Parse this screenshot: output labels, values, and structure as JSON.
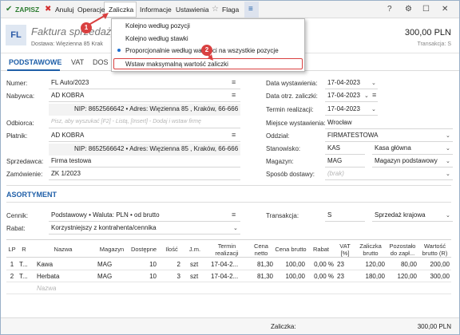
{
  "toolbar": {
    "save": "ZAPISZ",
    "cancel": "Anuluj",
    "operations": "Operacje",
    "advance": "Zaliczka",
    "info": "Informacje",
    "settings": "Ustawienia",
    "flag": "Flaga",
    "help": "?",
    "menu_glyph": "≡"
  },
  "header": {
    "badge": "FL",
    "title": "Faktura sprzedaży",
    "subtitle": "Dostawa: Więzienna 85 Krak",
    "amount": "300,00 PLN",
    "transaction": "Transakcja: S"
  },
  "tabs": [
    "PODSTAWOWE",
    "VAT",
    "DOS"
  ],
  "form_left": {
    "numer_label": "Numer:",
    "numer_value": "FL Auto/2023",
    "nabywca_label": "Nabywca:",
    "nabywca_value": "AD KOBRA",
    "nabywca_details": "NIP: 8652566642  •  Adres: Więzienna 85 , Kraków, 66-666",
    "odbiorca_label": "Odbiorca:",
    "odbiorca_placeholder": "Pisz, aby wyszukać [F2] - Listą, [Insert] - Dodaj i wstaw firmę",
    "platnik_label": "Płatnik:",
    "platnik_value": "AD KOBRA",
    "platnik_details": "NIP: 8652566642  •  Adres: Więzienna 85 , Kraków, 66-666",
    "sprzedawca_label": "Sprzedawca:",
    "sprzedawca_value": "Firma testowa",
    "zamowienie_label": "Zamówienie:",
    "zamowienie_value": "ZK 1/2023"
  },
  "form_right": {
    "data_wyst_label": "Data wystawienia:",
    "data_wyst_value": "17-04-2023",
    "data_otrz_label": "Data otrz. zaliczki:",
    "data_otrz_value": "17-04-2023",
    "termin_label": "Termin realizacji:",
    "termin_value": "17-04-2023",
    "miejsce_label": "Miejsce wystawienia:",
    "miejsce_value": "Wrocław",
    "oddzial_label": "Oddział:",
    "oddzial_value": "FIRMATESTOWA",
    "stanowisko_label": "Stanowisko:",
    "stanowisko_code": "KAS",
    "stanowisko_name": "Kasa główna",
    "magazyn_label": "Magazyn:",
    "magazyn_code": "MAG",
    "magazyn_name": "Magazyn podstawowy",
    "sposob_label": "Sposób dostawy:",
    "sposob_placeholder": "(brak)"
  },
  "assortment": {
    "title": "ASORTYMENT",
    "cennik_label": "Cennik:",
    "cennik_value": "Podstawowy  •  Waluta: PLN  •  od brutto",
    "rabat_label": "Rabat:",
    "rabat_value": "Korzystniejszy z kontrahenta/cennika",
    "transakcja_label": "Transakcja:",
    "transakcja_code": "S",
    "transakcja_name": "Sprzedaż krajowa"
  },
  "table": {
    "headers": [
      "LP",
      "R",
      "Nazwa",
      "Magazyn",
      "Dostępne",
      "Ilość",
      "J.m.",
      "Termin realizacji",
      "Cena netto",
      "Cena brutto",
      "Rabat",
      "VAT [%]",
      "Zaliczka brutto",
      "Pozostało do zapł...",
      "Wartość brutto (R)"
    ],
    "rows": [
      [
        "1",
        "T...",
        "Kawa",
        "MAG",
        "10",
        "2",
        "szt",
        "17-04-2...",
        "81,30",
        "100,00",
        "0,00 %",
        "23",
        "120,00",
        "80,00",
        "200,00"
      ],
      [
        "2",
        "T...",
        "Herbata",
        "MAG",
        "10",
        "3",
        "szt",
        "17-04-2...",
        "81,30",
        "100,00",
        "0,00 %",
        "23",
        "180,00",
        "120,00",
        "300,00"
      ]
    ],
    "new_row_placeholder": "Nazwa"
  },
  "footer": {
    "label": "Zaliczka:",
    "value": "300,00 PLN"
  },
  "advance_menu": {
    "items": [
      "Kolejno według pozycji",
      "Kolejno według stawki",
      "Proporcjonalnie według wartości na wszystkie pozycje",
      "Wstaw maksymalną wartość zaliczki"
    ],
    "selected_index": 2
  },
  "callouts": [
    "1",
    "2"
  ],
  "colors": {
    "accent": "#1f5fa8",
    "highlight": "#d94040",
    "save": "#2e7d32"
  }
}
